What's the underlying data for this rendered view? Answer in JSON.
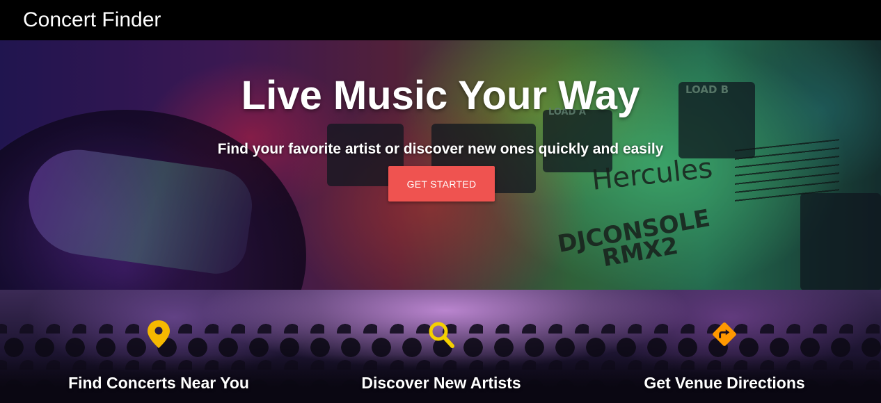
{
  "navbar": {
    "brand": "Concert Finder"
  },
  "hero": {
    "title": "Live Music Your Way",
    "subtitle": "Find your favorite artist or discover new ones quickly and easily",
    "cta_label": "GET STARTED",
    "cta_color": "#ef5350",
    "background_text": {
      "load_a": "LOAD A",
      "load_b": "LOAD B",
      "brand": "Hercules",
      "model_line1": "DJCONSOLE",
      "model_line2": "RMX2"
    }
  },
  "features": [
    {
      "icon": "location-pin-icon",
      "icon_color": "#f5b800",
      "title": "Find Concerts Near You"
    },
    {
      "icon": "search-icon",
      "icon_color": "#f5d000",
      "title": "Discover New Artists"
    },
    {
      "icon": "directions-icon",
      "icon_color": "#ff9800",
      "title": "Get Venue Directions"
    }
  ]
}
